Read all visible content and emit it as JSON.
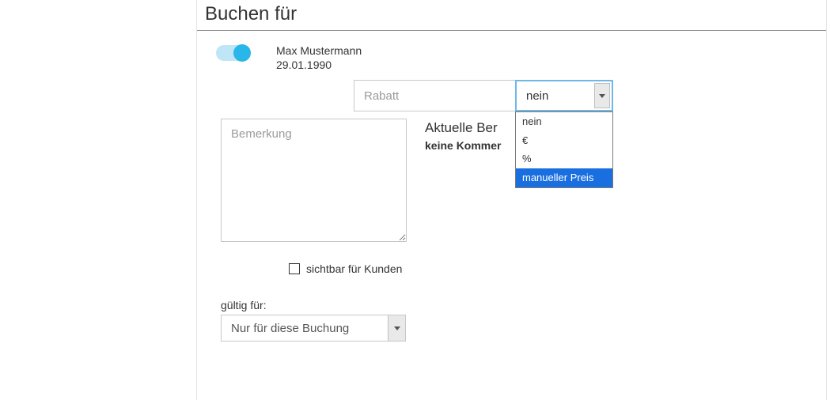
{
  "section": {
    "title": "Buchen für"
  },
  "customer": {
    "name": "Max Mustermann",
    "dob": "29.01.1990",
    "toggle_on": true
  },
  "rabatt": {
    "placeholder": "Rabatt",
    "value": "",
    "selected": "nein",
    "options": [
      "nein",
      "€",
      "%",
      "manueller Preis"
    ],
    "highlighted_index": 3
  },
  "bemerkung": {
    "placeholder": "Bemerkung",
    "value": ""
  },
  "aktuelle": {
    "heading": "Aktuelle Bemerkungen",
    "heading_visible_prefix": "Aktuelle Ber",
    "none_text": "keine Kommentare vorhanden",
    "none_text_visible_prefix": "keine Kommer"
  },
  "visible_for_customers": {
    "label": "sichtbar für Kunden",
    "checked": false
  },
  "gueltig": {
    "label": "gültig für:",
    "selected": "Nur für diese Buchung"
  }
}
